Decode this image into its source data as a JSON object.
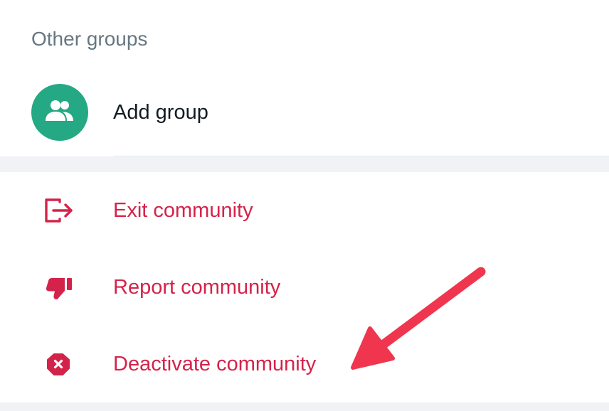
{
  "other_groups": {
    "title": "Other groups",
    "add_group_label": "Add group"
  },
  "actions": {
    "exit_label": "Exit community",
    "report_label": "Report community",
    "deactivate_label": "Deactivate community"
  },
  "colors": {
    "accent_green": "#25a884",
    "danger_red": "#d4234a",
    "annotation_arrow": "#f0364f"
  },
  "icons": {
    "add_group": "group-icon",
    "exit": "exit-icon",
    "report": "thumbs-down-icon",
    "deactivate": "octagon-x-icon"
  }
}
